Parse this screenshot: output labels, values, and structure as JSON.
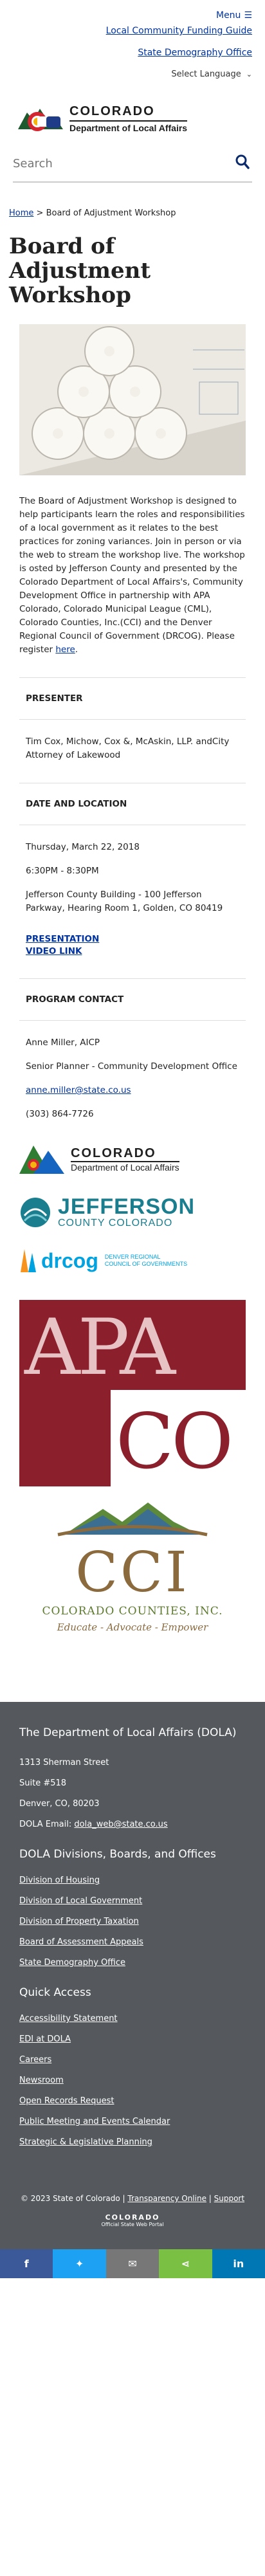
{
  "header": {
    "menu_label": "Menu",
    "top_links": [
      "Local Community Funding Guide",
      "State Demography Office"
    ],
    "language_label": "Select Language",
    "logo_line1": "COLORADO",
    "logo_line2": "Department of Local Affairs",
    "search_placeholder": "Search"
  },
  "breadcrumb": {
    "home": "Home",
    "sep": ">",
    "current": "Board of Adjustment Workshop"
  },
  "page": {
    "title": "Board of Adjustment Workshop",
    "description": " The Board of Adjustment Workshop is designed to help participants learn the roles and responsibilities of a local government as it relates to the best practices for zoning variances.  Join in person or via the web to stream the workshop live. The workshop is osted by Jefferson County and presented by the Colorado Department of Local Affairs's, Community Development Office in partnership with APA Colorado, Colorado Municipal League (CML), Colorado Counties, Inc.(CCI) and the Denver Regional Council of Government (DRCOG). Please register ",
    "register_link": "here",
    "description_end": "."
  },
  "presenter": {
    "heading": "PRESENTER",
    "text": "Tim Cox, Michow, Cox &, McAskin, LLP. andCity Attorney of Lakewood"
  },
  "date_location": {
    "heading": "DATE AND LOCATION",
    "date": "Thursday, March 22, 2018",
    "time": "6:30PM - 8:30PM",
    "location": "Jefferson County Building - 100 Jefferson Parkway, Hearing Room 1, Golden, CO 80419"
  },
  "links": {
    "presentation": "PRESENTATION",
    "video": "VIDEO LINK"
  },
  "contact": {
    "heading": "PROGRAM CONTACT",
    "name": "Anne Miller, AICP",
    "title": "Senior Planner - Community Development Office",
    "email": "anne.miller@state.co.us",
    "phone": "(303) 864-7726"
  },
  "partner_logos": {
    "dola_badge": "DOLA",
    "dola_line1": "COLORADO",
    "dola_line2": "Department of Local Affairs",
    "jc_line1": "JEFFERSON",
    "jc_line2": "COUNTY COLORADO",
    "drcog_name": "drcog",
    "drcog_sub1": "DENVER REGIONAL",
    "drcog_sub2": "COUNCIL OF GOVERNMENTS",
    "apa_line1": "APA",
    "apa_line2": "CO",
    "cci_mark": "CCI",
    "cci_name": "COLORADO COUNTIES, INC.",
    "cci_tagline": "Educate - Advocate - Empower"
  },
  "footer": {
    "org_title": "The Department of Local Affairs (DOLA)",
    "address1": "1313 Sherman Street",
    "address2": "Suite  #518",
    "address3": "Denver, CO, 80203",
    "email_label": "DOLA Email:",
    "email": "dola_web@state.co.us",
    "divisions_title": "DOLA Divisions, Boards, and Offices",
    "divisions": [
      "Division of Housing",
      "Division of Local Government",
      "Division of Property Taxation",
      "Board of Assessment Appeals",
      "State Demography Office"
    ],
    "quick_title": "Quick Access",
    "quick": [
      "Accessibility Statement",
      "EDI at DOLA",
      "Careers",
      "Newsroom",
      "Open Records Request",
      "Public Meeting and Events Calendar",
      "Strategic & Legislative Planning"
    ],
    "copyright": "© 2023 State of Colorado",
    "transparency": "Transparency Online",
    "support": "Support",
    "footer_logo_line1": "COLORADO",
    "footer_logo_line2": "Official State Web Portal"
  },
  "share": {
    "colors": [
      "#3b5998",
      "#1da1f2",
      "#777777",
      "#7ac143",
      "#0077b5"
    ],
    "icons": [
      "facebook-icon",
      "twitter-icon",
      "email-icon",
      "share-icon",
      "linkedin-icon"
    ]
  }
}
